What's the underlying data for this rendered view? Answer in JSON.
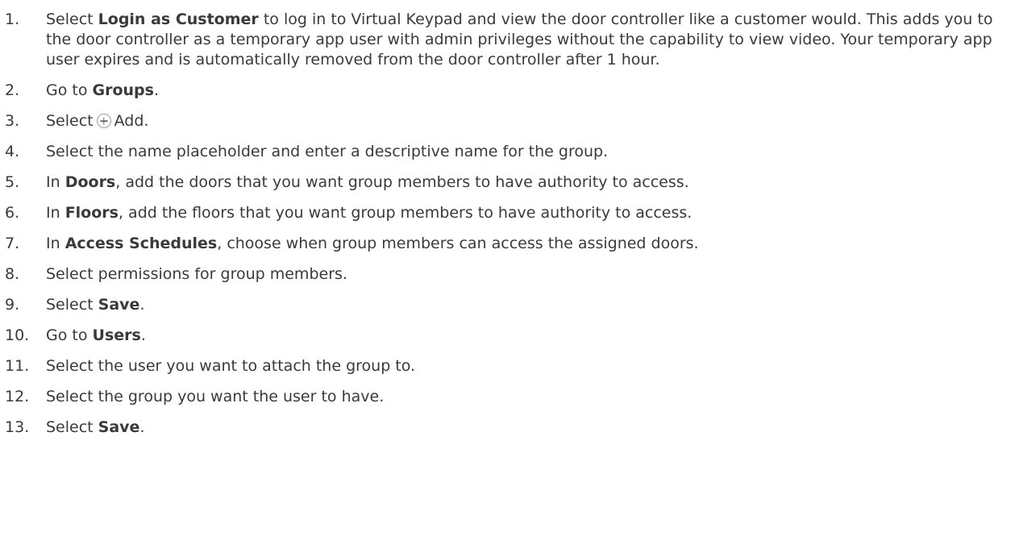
{
  "steps": [
    {
      "num": "1.",
      "parts": [
        {
          "t": "Select "
        },
        {
          "b": "Login as Customer"
        },
        {
          "t": " to log in to Virtual Keypad and view the door controller like a customer would. This adds you to the door controller as a temporary app user with admin privileges without the capability to view video. Your temporary app user expires and is automatically removed from the door controller after 1 hour."
        }
      ]
    },
    {
      "num": "2.",
      "parts": [
        {
          "t": "Go to "
        },
        {
          "b": "Groups"
        },
        {
          "t": "."
        }
      ]
    },
    {
      "num": "3.",
      "parts": [
        {
          "t": "Select"
        },
        {
          "icon": "add-circle-icon"
        },
        {
          "t": "Add."
        }
      ]
    },
    {
      "num": "4.",
      "parts": [
        {
          "t": "Select the name placeholder and enter a descriptive name for the group."
        }
      ]
    },
    {
      "num": "5.",
      "parts": [
        {
          "t": "In "
        },
        {
          "b": "Doors"
        },
        {
          "t": ", add the doors that you want group members to have authority to access."
        }
      ]
    },
    {
      "num": "6.",
      "parts": [
        {
          "t": "In "
        },
        {
          "b": "Floors"
        },
        {
          "t": ", add the floors that you want group members to have authority to access."
        }
      ]
    },
    {
      "num": "7.",
      "parts": [
        {
          "t": "In "
        },
        {
          "b": "Access Schedules"
        },
        {
          "t": ", choose when group members can access the assigned doors."
        }
      ]
    },
    {
      "num": "8.",
      "parts": [
        {
          "t": "Select permissions for group members."
        }
      ]
    },
    {
      "num": "9.",
      "parts": [
        {
          "t": "Select "
        },
        {
          "b": "Save"
        },
        {
          "t": "."
        }
      ]
    },
    {
      "num": "10.",
      "parts": [
        {
          "t": "Go to "
        },
        {
          "b": "Users"
        },
        {
          "t": "."
        }
      ]
    },
    {
      "num": "11.",
      "parts": [
        {
          "t": "Select the user you want to attach the group to."
        }
      ]
    },
    {
      "num": "12.",
      "parts": [
        {
          "t": "Select the group you want the user to have."
        }
      ]
    },
    {
      "num": "13.",
      "parts": [
        {
          "t": "Select "
        },
        {
          "b": "Save"
        },
        {
          "t": "."
        }
      ]
    }
  ],
  "colors": {
    "text": "#3a3a3a",
    "icon_border": "#9a9a9a"
  }
}
